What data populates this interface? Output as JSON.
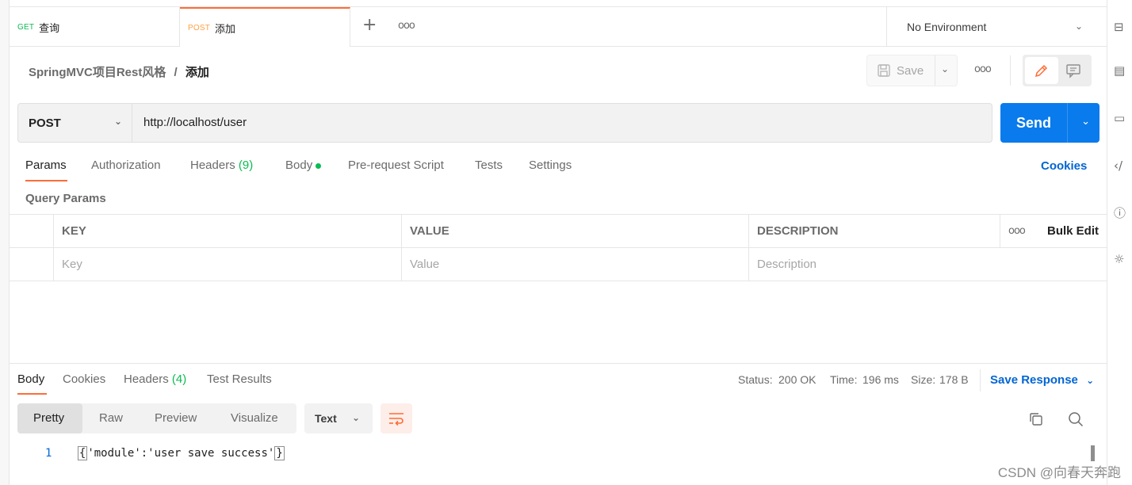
{
  "tabs": [
    {
      "method": "GET",
      "name": "查询",
      "method_color": "#0cbb52"
    },
    {
      "method": "POST",
      "name": "添加",
      "method_color": "#ff9f43"
    }
  ],
  "environment": "No Environment",
  "breadcrumb": {
    "collection": "SpringMVC项目Rest风格",
    "separator": "/",
    "request": "添加"
  },
  "save_label": "Save",
  "request": {
    "method": "POST",
    "url": "http://localhost/user"
  },
  "send_label": "Send",
  "request_tabs": [
    {
      "label": "Params",
      "active": true
    },
    {
      "label": "Authorization"
    },
    {
      "label": "Headers",
      "count": "(9)"
    },
    {
      "label": "Body",
      "dot": true
    },
    {
      "label": "Pre-request Script"
    },
    {
      "label": "Tests"
    },
    {
      "label": "Settings"
    }
  ],
  "cookies_link": "Cookies",
  "query_params_title": "Query Params",
  "table": {
    "headers": {
      "key": "KEY",
      "value": "VALUE",
      "description": "DESCRIPTION",
      "bulk_edit": "Bulk Edit"
    },
    "placeholders": {
      "key": "Key",
      "value": "Value",
      "description": "Description"
    }
  },
  "response_tabs": [
    {
      "label": "Body",
      "active": true
    },
    {
      "label": "Cookies"
    },
    {
      "label": "Headers",
      "count": "(4)"
    },
    {
      "label": "Test Results"
    }
  ],
  "status": {
    "status_label": "Status:",
    "status_value": "200 OK",
    "time_label": "Time:",
    "time_value": "196 ms",
    "size_label": "Size:",
    "size_value": "178 B"
  },
  "save_response": "Save Response",
  "view_modes": [
    "Pretty",
    "Raw",
    "Preview",
    "Visualize"
  ],
  "format": "Text",
  "response_body": {
    "line": "1",
    "open": "{",
    "content": "'module':'user save success'",
    "close": "}"
  },
  "watermark": "CSDN @向春天奔跑",
  "colors": {
    "accent": "#ff6c37",
    "send": "#097bed",
    "success": "#0cbb52",
    "link": "#0265d2"
  }
}
